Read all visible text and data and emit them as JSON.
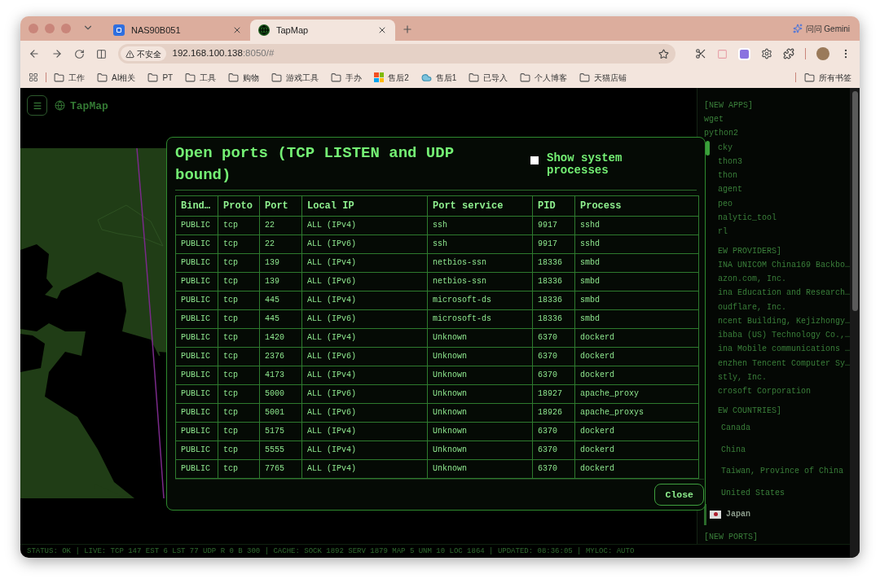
{
  "browser": {
    "tabs": [
      {
        "title": "NAS90B051",
        "selected": false,
        "kind": "nas"
      },
      {
        "title": "TapMap",
        "selected": true,
        "kind": "globe"
      }
    ],
    "assistant": "问问 Gemini",
    "security": "不安全",
    "url_host": "192.168.100.138",
    "url_rest": ":8050/#",
    "bookmarks": [
      {
        "label": "工作",
        "kind": "folder"
      },
      {
        "label": "AI相关",
        "kind": "folder"
      },
      {
        "label": "PT",
        "kind": "folder"
      },
      {
        "label": "工具",
        "kind": "folder"
      },
      {
        "label": "购物",
        "kind": "folder"
      },
      {
        "label": "游戏工具",
        "kind": "folder"
      },
      {
        "label": "手办",
        "kind": "folder"
      },
      {
        "label": "售后2",
        "kind": "tiles"
      },
      {
        "label": "售后1",
        "kind": "cloud"
      },
      {
        "label": "已导入",
        "kind": "folder"
      },
      {
        "label": "个人博客",
        "kind": "folder"
      },
      {
        "label": "天猫店铺",
        "kind": "folder"
      }
    ],
    "all_bookmarks": "所有书签"
  },
  "app": {
    "title": "TapMap"
  },
  "modal": {
    "title": "Open ports (TCP LISTEN and UDP bound)",
    "show_system": {
      "label": "Show system processes",
      "checked": false
    },
    "columns": [
      "Bind…",
      "Proto",
      "Port",
      "Local IP",
      "Port service",
      "PID",
      "Process"
    ],
    "rows": [
      [
        "PUBLIC",
        "tcp",
        "22",
        "ALL (IPv4)",
        "ssh",
        "9917",
        "sshd"
      ],
      [
        "PUBLIC",
        "tcp",
        "22",
        "ALL (IPv6)",
        "ssh",
        "9917",
        "sshd"
      ],
      [
        "PUBLIC",
        "tcp",
        "139",
        "ALL (IPv4)",
        "netbios-ssn",
        "18336",
        "smbd"
      ],
      [
        "PUBLIC",
        "tcp",
        "139",
        "ALL (IPv6)",
        "netbios-ssn",
        "18336",
        "smbd"
      ],
      [
        "PUBLIC",
        "tcp",
        "445",
        "ALL (IPv4)",
        "microsoft-ds",
        "18336",
        "smbd"
      ],
      [
        "PUBLIC",
        "tcp",
        "445",
        "ALL (IPv6)",
        "microsoft-ds",
        "18336",
        "smbd"
      ],
      [
        "PUBLIC",
        "tcp",
        "1420",
        "ALL (IPv4)",
        "Unknown",
        "6370",
        "dockerd"
      ],
      [
        "PUBLIC",
        "tcp",
        "2376",
        "ALL (IPv6)",
        "Unknown",
        "6370",
        "dockerd"
      ],
      [
        "PUBLIC",
        "tcp",
        "4173",
        "ALL (IPv4)",
        "Unknown",
        "6370",
        "dockerd"
      ],
      [
        "PUBLIC",
        "tcp",
        "5000",
        "ALL (IPv6)",
        "Unknown",
        "18927",
        "apache_proxy"
      ],
      [
        "PUBLIC",
        "tcp",
        "5001",
        "ALL (IPv6)",
        "Unknown",
        "18926",
        "apache_proxys"
      ],
      [
        "PUBLIC",
        "tcp",
        "5175",
        "ALL (IPv4)",
        "Unknown",
        "6370",
        "dockerd"
      ],
      [
        "PUBLIC",
        "tcp",
        "5555",
        "ALL (IPv4)",
        "Unknown",
        "6370",
        "dockerd"
      ],
      [
        "PUBLIC",
        "tcp",
        "7765",
        "ALL (IPv4)",
        "Unknown",
        "6370",
        "dockerd"
      ]
    ],
    "close": "Close"
  },
  "sidebar": {
    "sections": [
      {
        "kind": "list",
        "heading": {
          "text": "[NEW APPS]"
        },
        "items": [
          {
            "text": "wget"
          },
          {
            "text": "python2"
          },
          {
            "text": "cky",
            "covered": true
          },
          {
            "text": "thon3",
            "covered": true
          },
          {
            "text": "thon",
            "covered": true
          },
          {
            "text": "agent",
            "covered": true
          },
          {
            "text": "peo",
            "covered": true
          },
          {
            "text": "nalytic_tool",
            "covered": true
          },
          {
            "text": "rl",
            "covered": true
          }
        ]
      },
      {
        "kind": "list",
        "heading": {
          "text": "EW PROVIDERS]",
          "covered": true
        },
        "items": [
          {
            "text": "INA UNICOM China169 Backbo…",
            "covered": true
          },
          {
            "text": "azon.com, Inc.",
            "covered": true
          },
          {
            "text": "ina Education and Research…",
            "covered": true
          },
          {
            "text": "oudflare, Inc.",
            "covered": true
          },
          {
            "text": "ncent Building, Kejizhongy…",
            "covered": true
          },
          {
            "text": "ibaba (US) Technology Co.,…",
            "covered": true
          },
          {
            "text": "ina Mobile communications …",
            "covered": true
          },
          {
            "text": "enzhen Tencent Computer Sy…",
            "covered": true
          },
          {
            "text": "stly, Inc.",
            "covered": true
          },
          {
            "text": "crosoft Corporation",
            "covered": true
          }
        ]
      },
      {
        "kind": "countries",
        "heading": {
          "text": "EW COUNTRIES]",
          "covered": true
        },
        "items": [
          {
            "text": "Canada",
            "covered": true,
            "selected": false
          },
          {
            "text": "China",
            "covered": true,
            "selected": false
          },
          {
            "text": "Taiwan, Province of China",
            "covered": true,
            "selected": false
          },
          {
            "text": "United States",
            "covered": true,
            "selected": false
          },
          {
            "text": "Japan",
            "covered": false,
            "selected": true
          }
        ]
      },
      {
        "kind": "heading",
        "heading": {
          "text": "[NEW PORTS]"
        }
      }
    ]
  },
  "status_bar": "STATUS: OK | LIVE: TCP 147 EST 6 LST 77 UDP R 0 B 300 | CACHE: SOCK 1892 SERV 1879 MAP 5 UNM 10 LOC 1864 | UPDATED: 08:36:05 | MYLOC: AUTO"
}
